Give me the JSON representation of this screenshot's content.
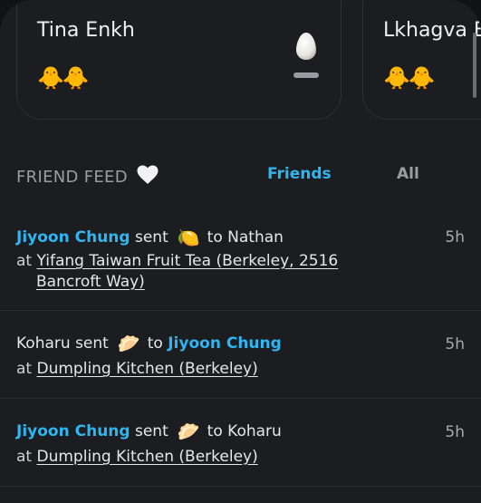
{
  "friend_cards": [
    {
      "name": "Tina Enkh",
      "chicks": "🐥🐥"
    },
    {
      "name": "Lkhagva E",
      "chicks": "🐥🐥"
    }
  ],
  "feed": {
    "title": "FRIEND FEED",
    "tabs": {
      "friends": "Friends",
      "all": "All"
    },
    "items": [
      {
        "sender": "Jiyoon Chung",
        "verb": "sent",
        "gift": "🍋",
        "to_prefix": "to",
        "recipient": "Nathan",
        "time": "5h",
        "at": "at",
        "place_line1": "Yifang Taiwan Fruit Tea (Berkeley, 2516",
        "place_line2": "Bancroft Way)"
      },
      {
        "sender": "Koharu",
        "verb": "sent",
        "gift": "🥟",
        "to_prefix": "to",
        "recipient": "Jiyoon Chung",
        "time": "5h",
        "at": "at",
        "place": "Dumpling Kitchen (Berkeley)"
      },
      {
        "sender": "Jiyoon Chung",
        "verb": "sent",
        "gift": "🥟",
        "to_prefix": "to",
        "recipient": "Koharu",
        "time": "5h",
        "at": "at",
        "place": "Dumpling Kitchen (Berkeley)"
      }
    ]
  },
  "colors": {
    "accent": "#2fb5ef",
    "background": "#1c1d21"
  }
}
